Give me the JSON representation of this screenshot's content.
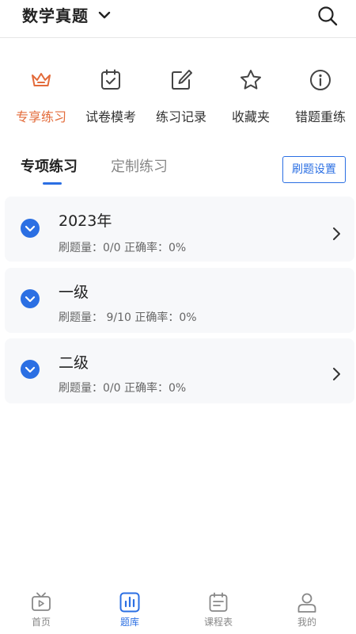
{
  "header": {
    "title": "数学真题",
    "icons": {
      "dropdown": "chevron-down-icon",
      "search": "search-icon"
    }
  },
  "categories": [
    {
      "label": "专享练习",
      "icon": "crown-icon",
      "active": true
    },
    {
      "label": "试卷模考",
      "icon": "calendar-check-icon",
      "active": false
    },
    {
      "label": "练习记录",
      "icon": "edit-icon",
      "active": false
    },
    {
      "label": "收藏夹",
      "icon": "star-icon",
      "active": false
    },
    {
      "label": "错题重练",
      "icon": "info-icon",
      "active": false
    }
  ],
  "tabs": [
    {
      "label": "专项练习",
      "active": true
    },
    {
      "label": "定制练习",
      "active": false
    }
  ],
  "settings_button": {
    "label": "刷题设置"
  },
  "sections": [
    {
      "title": "2023年",
      "stats": "刷题量：0/0 正确率：0%",
      "has_arrow": true
    },
    {
      "title": "一级",
      "stats": "刷题量：  9/10 正确率：0%",
      "has_arrow": false
    },
    {
      "title": "二级",
      "stats": "刷题量：0/0 正确率：0%",
      "has_arrow": true
    }
  ],
  "bottom_nav": [
    {
      "label": "首页",
      "icon": "tv-icon",
      "active": false
    },
    {
      "label": "题库",
      "icon": "bar-chart-icon",
      "active": true
    },
    {
      "label": "课程表",
      "icon": "schedule-icon",
      "active": false
    },
    {
      "label": "我的",
      "icon": "user-icon",
      "active": false
    }
  ],
  "colors": {
    "accent": "#2b6fe3",
    "active_category": "#e36b3a",
    "card_bg": "#f7f8fa",
    "icon_gray": "#444444",
    "nav_gray": "#888888"
  }
}
